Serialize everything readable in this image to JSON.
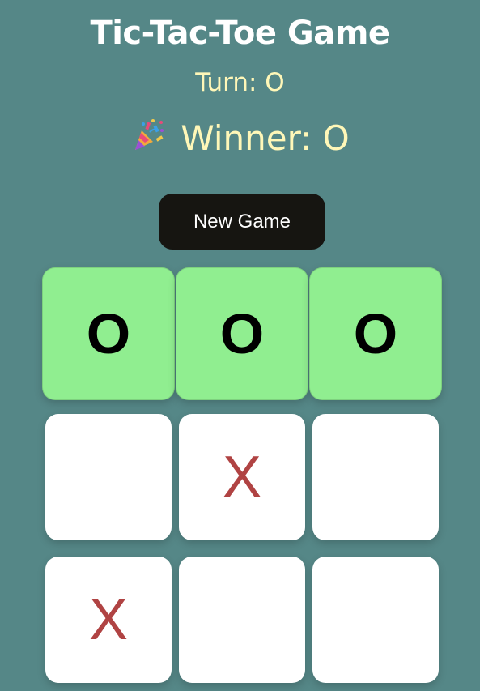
{
  "title": "Tic-Tac-Toe Game",
  "turn_text": "Turn: O",
  "winner_text": "Winner: O",
  "winner_icon": "party-popper-icon",
  "new_game_label": "New Game",
  "board": [
    [
      "O",
      "O",
      "O"
    ],
    [
      "",
      "X",
      ""
    ],
    [
      "X",
      "",
      ""
    ]
  ],
  "winning_row": 0,
  "colors": {
    "background": "#558787",
    "win_cell": "#90ee90",
    "x_mark": "#b04343",
    "status_text": "#fff7b8",
    "button": "#161511"
  }
}
